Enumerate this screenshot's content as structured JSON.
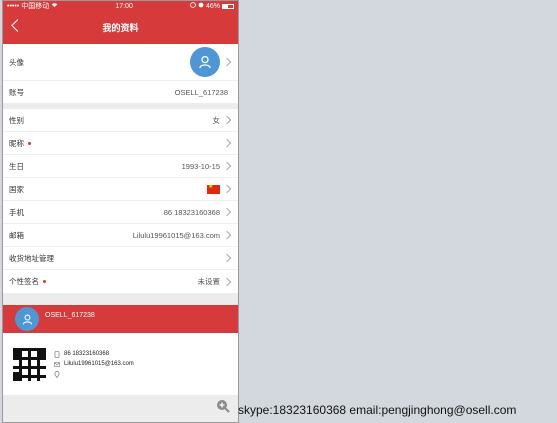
{
  "statusbar": {
    "carrier": "••••• 中国移动",
    "time": "17:00",
    "battery": "46%"
  },
  "navbar": {
    "title": "我的资料"
  },
  "profile": {
    "avatar_label": "头像",
    "account_label": "账号",
    "account_value": "OSELL_617238"
  },
  "details": [
    {
      "label": "性别",
      "value": "女"
    },
    {
      "label": "昵称",
      "value": ""
    },
    {
      "label": "生日",
      "value": "1993-10-15"
    },
    {
      "label": "国家",
      "value": ""
    },
    {
      "label": "手机",
      "value": "86 18323160368"
    },
    {
      "label": "邮箱",
      "value": "Lilulu19961015@163.com"
    },
    {
      "label": "收货地址管理",
      "value": ""
    },
    {
      "label": "个性签名",
      "value": "未设置"
    }
  ],
  "card": {
    "name": "OSELL_617238",
    "phone": "86 18323160368",
    "email": "Lilulu19961015@163.com"
  },
  "footer": {
    "text": "skype:18323160368 email:pengjinghong@osell.com"
  },
  "colors": {
    "accent": "#d73a3a",
    "avatar": "#4d97d6"
  }
}
